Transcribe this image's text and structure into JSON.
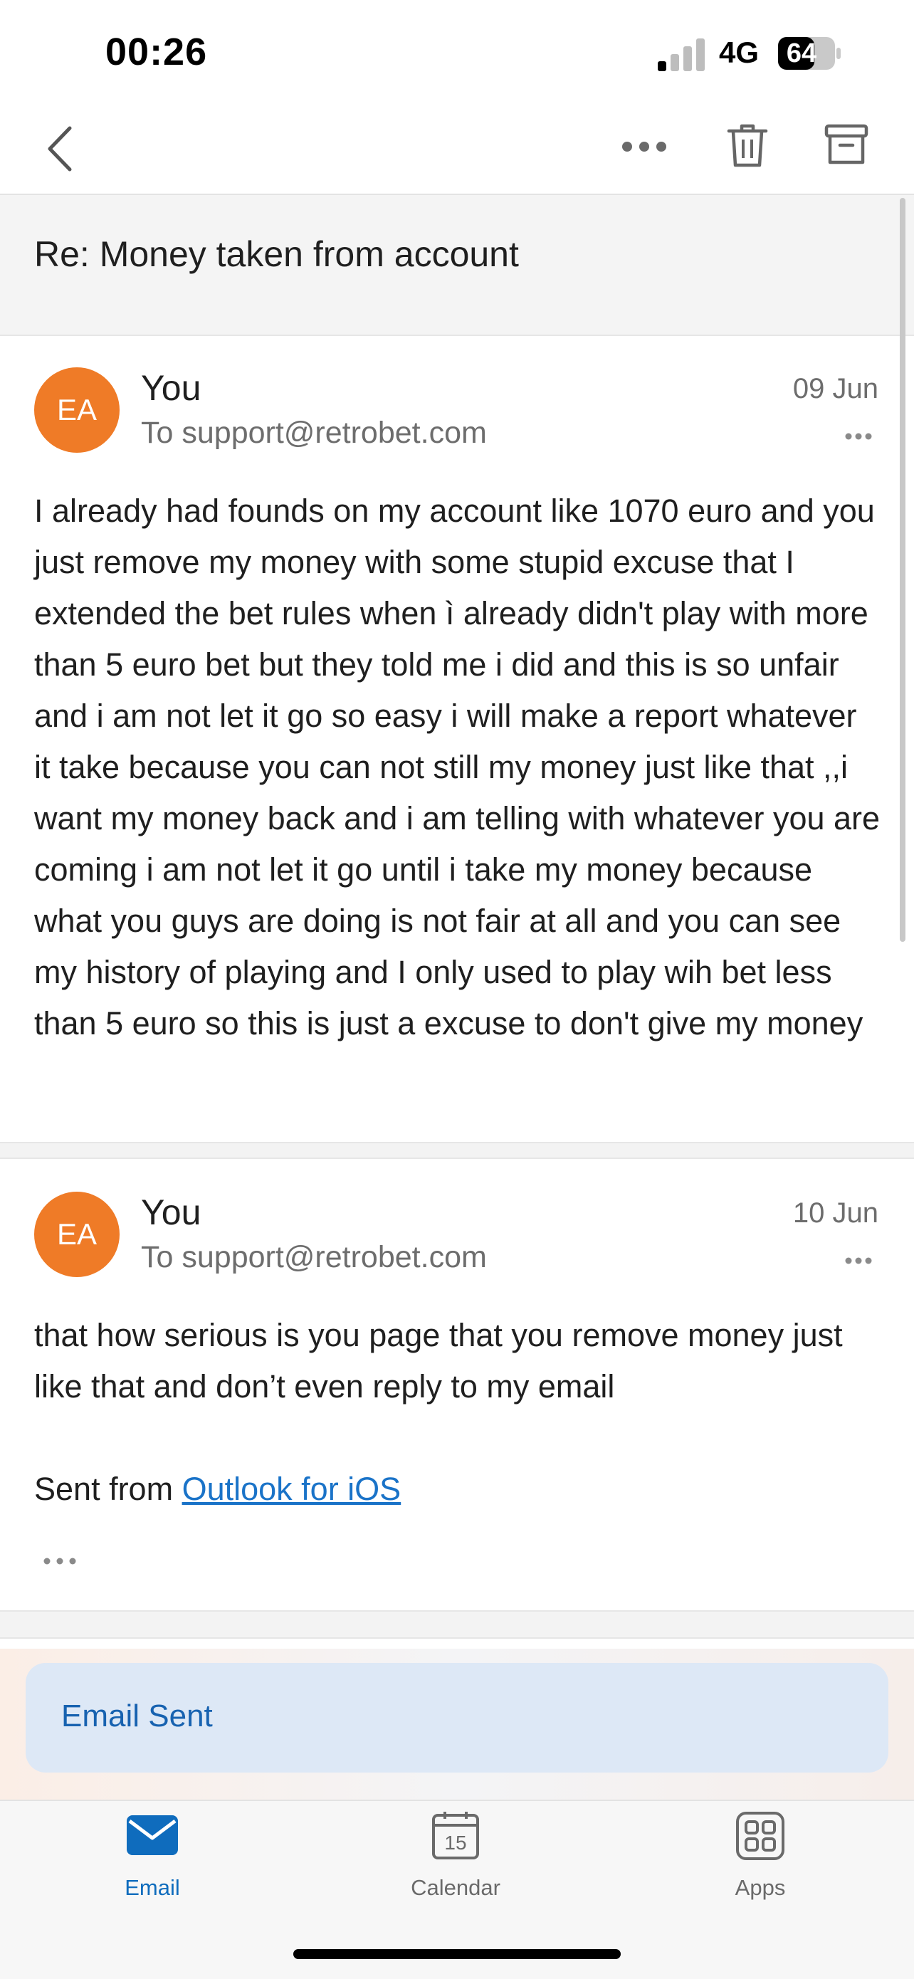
{
  "status_bar": {
    "time": "00:26",
    "network": "4G",
    "battery": "64",
    "battery_fraction": 0.64
  },
  "toolbar": {
    "back_icon": "chevron-left-icon",
    "more_icon": "more-icon",
    "trash_icon": "trash-icon",
    "archive_icon": "archive-icon"
  },
  "subject": "Re: Money taken from account",
  "messages": [
    {
      "avatar": "EA",
      "sender": "You",
      "recipient": "To support@retrobet.com",
      "date": "09 Jun",
      "body": "I already had founds on my account like 1070 euro and you just remove my money with some stupid excuse that I extended the bet rules when ì already didn't play with more than 5 euro bet but they told me i did and this is so unfair and i am not let it go so easy i will make a report whatever it take because you can not still my money just like that ,,i want my money back and i am telling with whatever you are coming i am not let it go until i take my money because what you guys are doing is not fair at all and you can see my history of playing and I only used to play wih bet less than 5 euro so this is just a excuse to don't give my money"
    },
    {
      "avatar": "EA",
      "sender": "You",
      "recipient": "To support@retrobet.com",
      "date": "10 Jun",
      "body": "that how serious is you page that you remove money just like that and don’t even reply to my email",
      "signature_prefix": "Sent from ",
      "signature_link": "Outlook for iOS"
    }
  ],
  "toast": {
    "text": "Email Sent"
  },
  "tabs": [
    {
      "label": "Email",
      "icon": "mail-icon",
      "active": true
    },
    {
      "label": "Calendar",
      "icon": "calendar-icon",
      "calendar_day": "15",
      "active": false
    },
    {
      "label": "Apps",
      "icon": "apps-grid-icon",
      "active": false
    }
  ],
  "colors": {
    "accent": "#0f6cbd",
    "avatar": "#ef7b27",
    "toast_bg": "#dde8f6",
    "link": "#1a73c8"
  }
}
